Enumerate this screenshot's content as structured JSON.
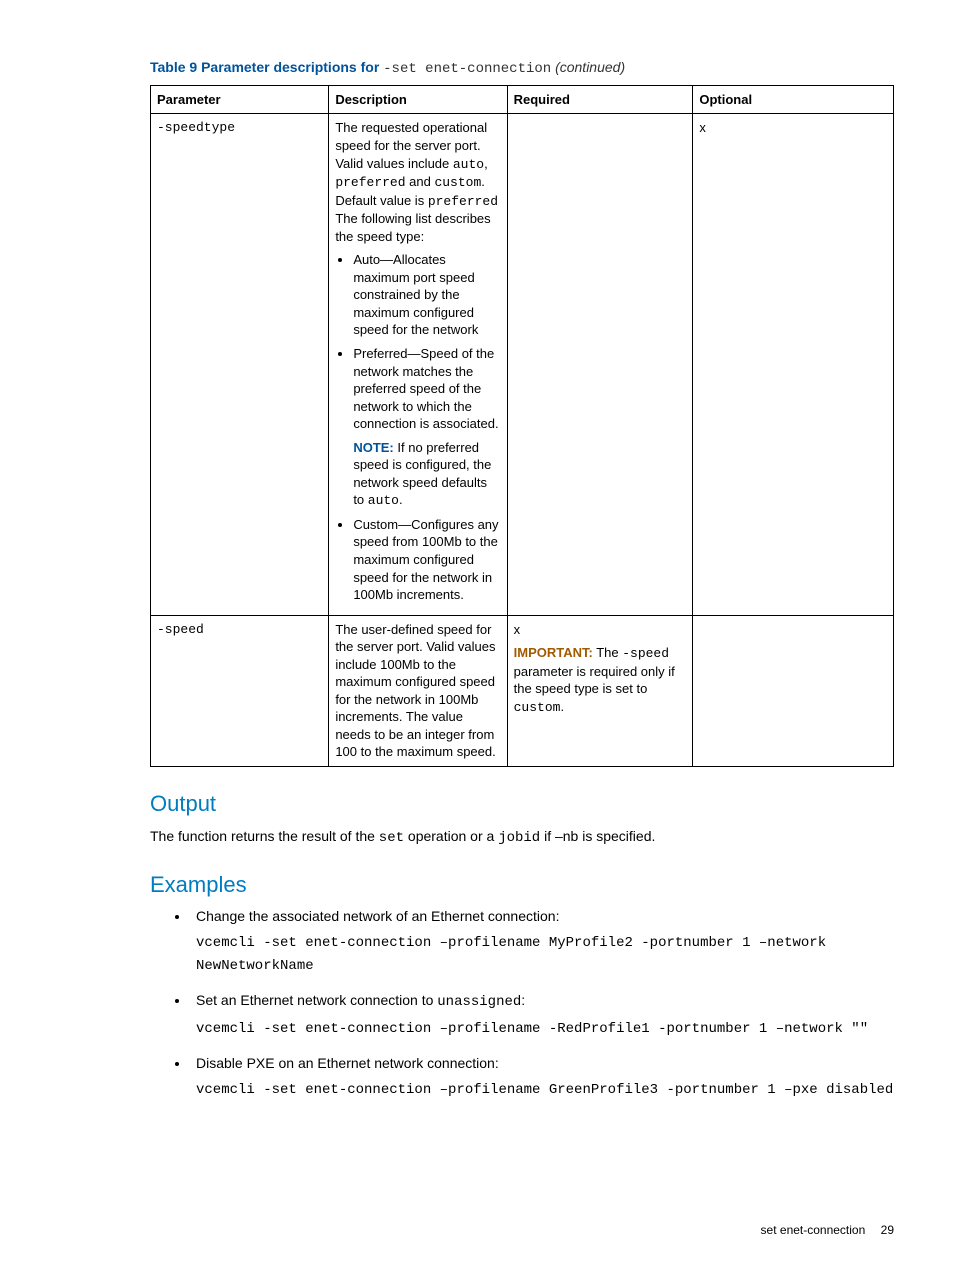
{
  "table": {
    "title_prefix": "Table 9 Parameter descriptions for ",
    "title_code": "-set enet-connection",
    "title_suffix": " (continued)",
    "headers": [
      "Parameter",
      "Description",
      "Required",
      "Optional"
    ],
    "rows": [
      {
        "param": "-speedtype",
        "desc_intro_1": "The requested operational speed for the server port. Valid values include ",
        "desc_code_auto": "auto",
        "desc_sep1": ", ",
        "desc_code_preferred": "preferred",
        "desc_sep2": " and ",
        "desc_code_custom": "custom",
        "desc_sep3": ". Default value is ",
        "desc_code_preferred2": "preferred",
        "desc_after_default": " The following list describes the speed type:",
        "bullet_auto": "Auto—Allocates maximum port speed constrained by the maximum configured speed for the network",
        "bullet_pref": "Preferred—Speed of the network matches the preferred speed of the network to which the connection is associated.",
        "note_label": "NOTE:",
        "note_text": " If no preferred speed is configured, the network speed defaults to ",
        "note_code": "auto",
        "note_end": ".",
        "bullet_custom": "Custom—Configures any speed from 100Mb to the maximum configured speed for the network in 100Mb increments.",
        "required": "",
        "optional": "x"
      },
      {
        "param": "-speed",
        "desc": "The user-defined speed for the server port. Valid values include 100Mb to the maximum configured speed for the network in 100Mb increments. The value needs to be an integer from 100 to the maximum speed.",
        "req_x": "x",
        "imp_label": "IMPORTANT:",
        "imp_pre": " The ",
        "imp_code": "-speed",
        "imp_post": " parameter is required only if the speed type is set to ",
        "imp_code2": "custom",
        "imp_end": ".",
        "optional": ""
      }
    ]
  },
  "output": {
    "heading": "Output",
    "text_pre": "The function returns the result of the ",
    "code1": "set",
    "text_mid": " operation or a ",
    "code2": "jobid",
    "text_post": " if –nb is specified."
  },
  "examples": {
    "heading": "Examples",
    "items": [
      {
        "intro": "Change the associated network of an Ethernet connection:",
        "code": "vcemcli -set enet-connection –profilename MyProfile2 -portnumber 1 –network NewNetworkName"
      },
      {
        "intro_pre": "Set an Ethernet network connection to ",
        "intro_code": "unassigned",
        "intro_post": ":",
        "code": "vcemcli -set enet-connection –profilename -RedProfile1 -portnumber 1 –network \"\""
      },
      {
        "intro": "Disable PXE on an Ethernet network connection:",
        "code": "vcemcli -set enet-connection –profilename GreenProfile3 -portnumber 1 –pxe disabled"
      }
    ]
  },
  "footer": {
    "section": "set enet-connection",
    "page": "29"
  }
}
